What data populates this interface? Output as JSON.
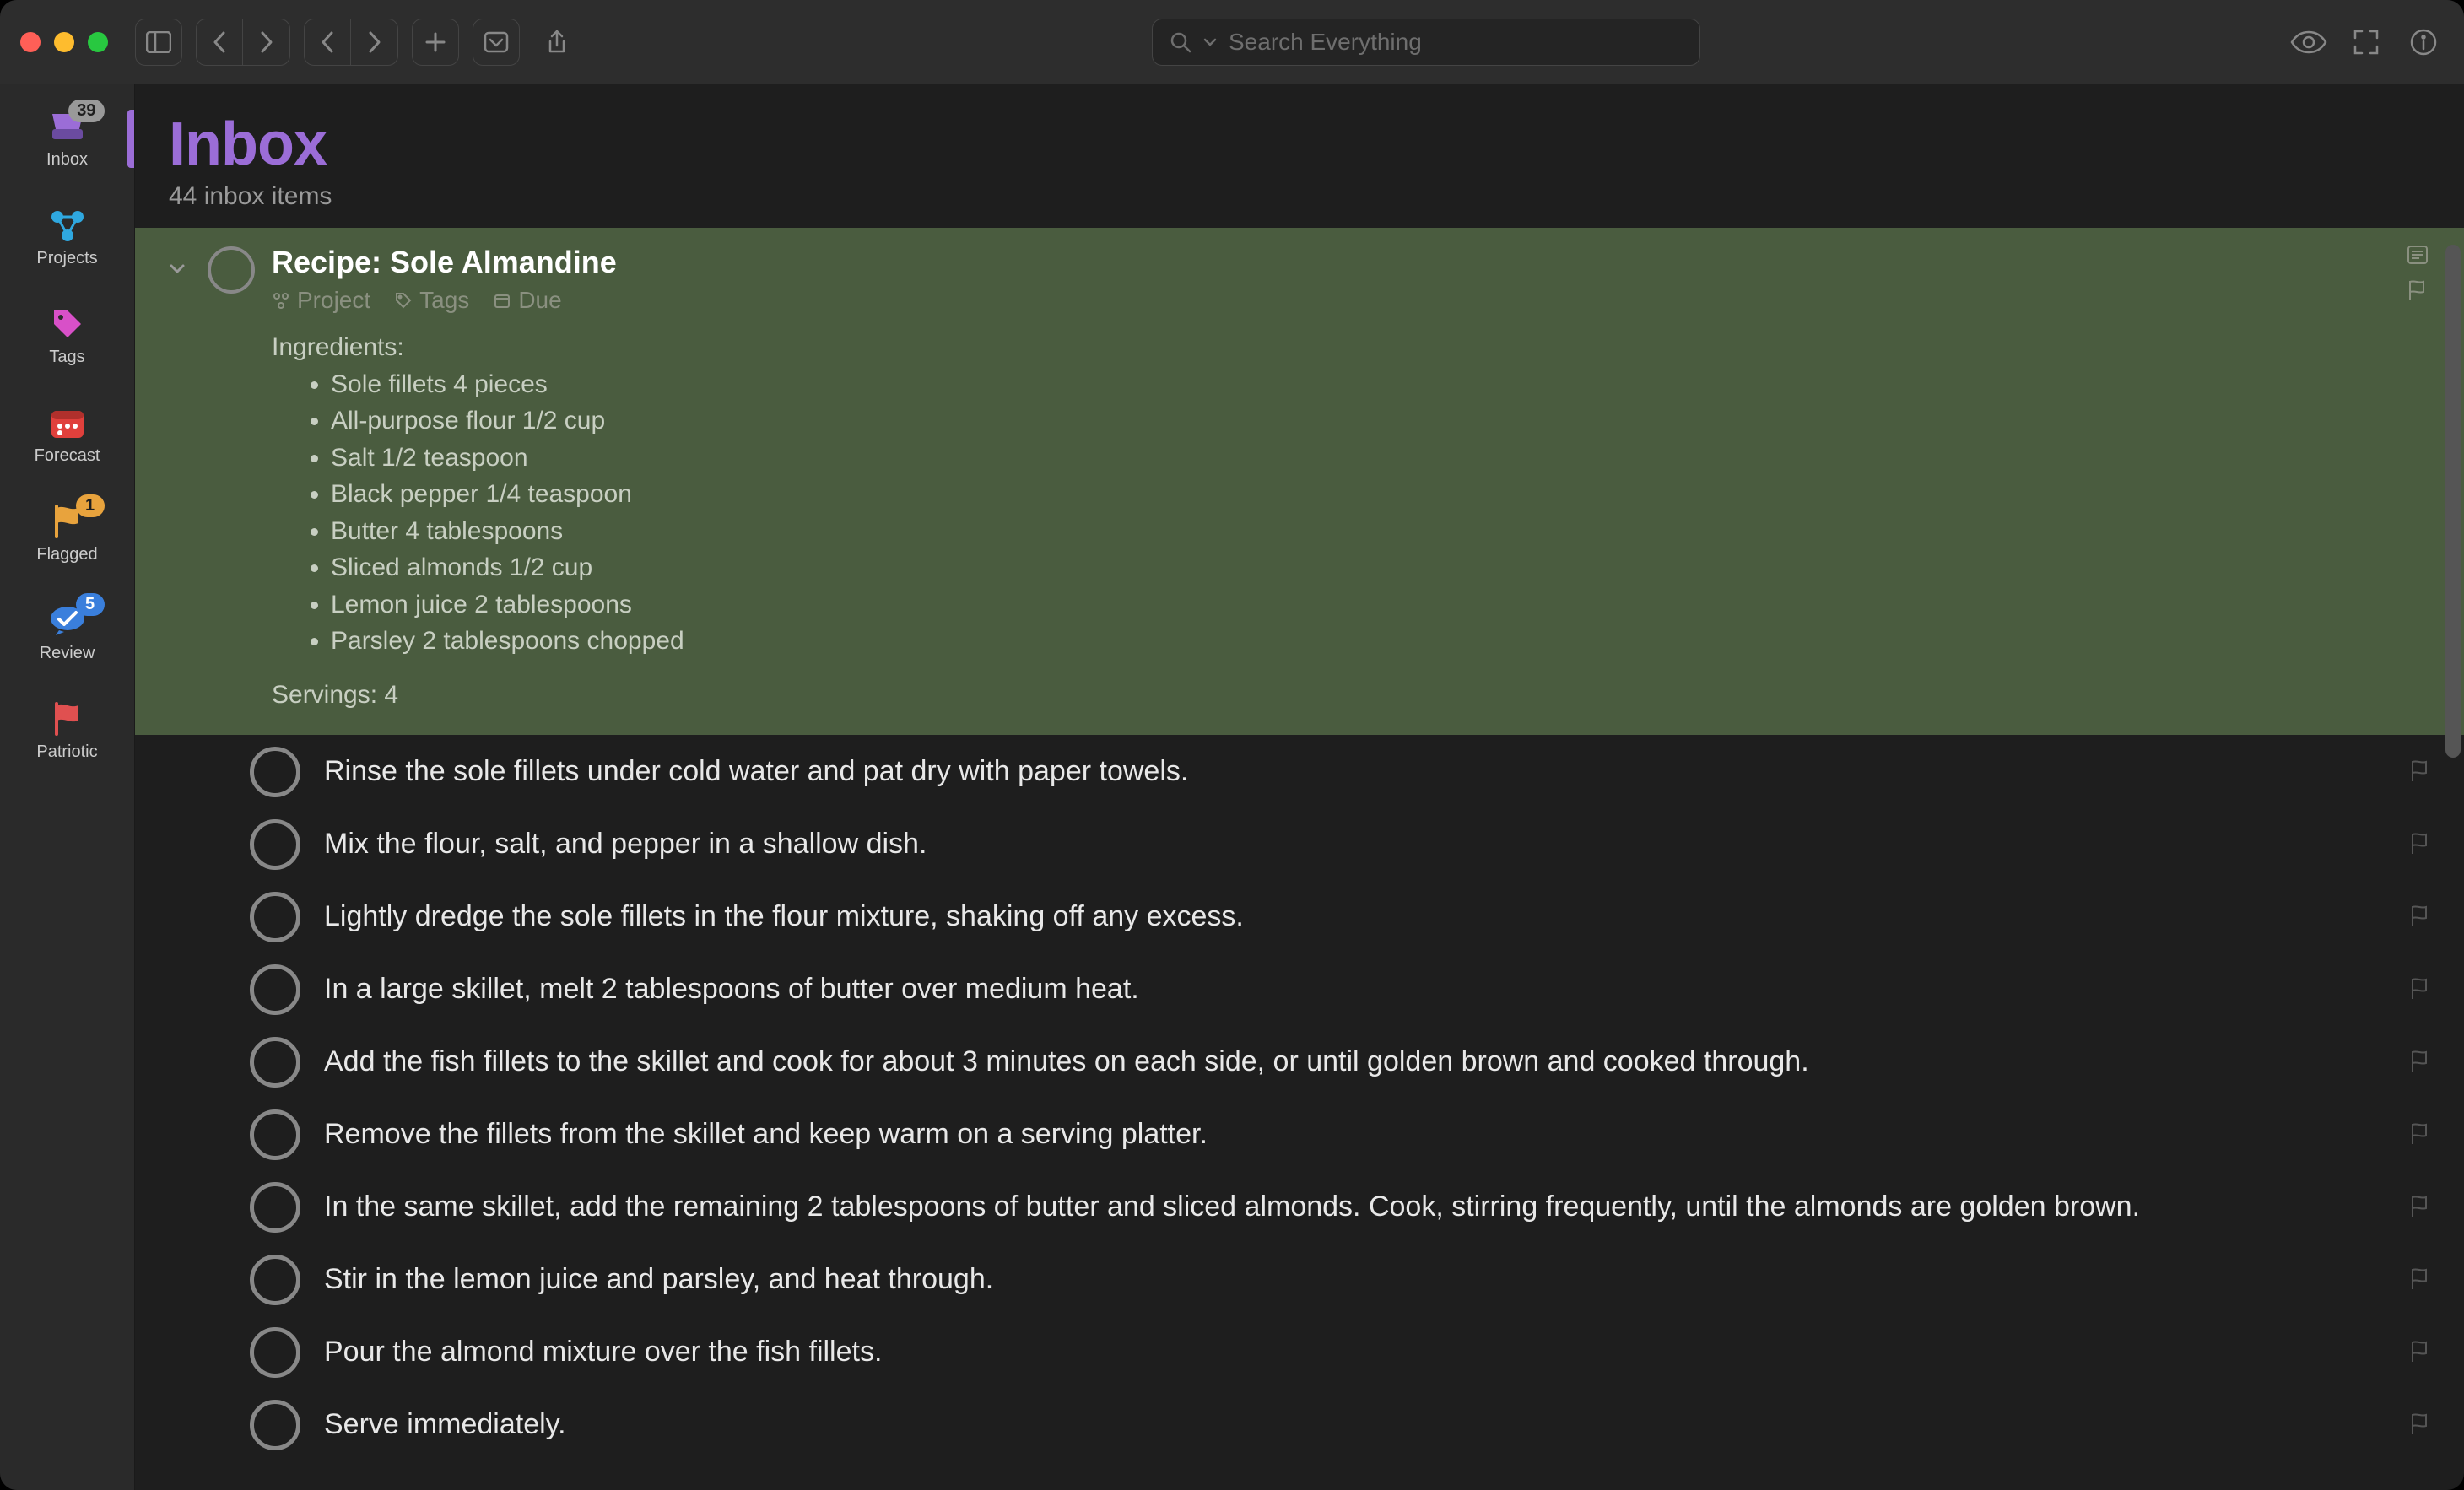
{
  "search": {
    "placeholder": "Search Everything"
  },
  "sidebar": {
    "items": [
      {
        "label": "Inbox",
        "badge": "39",
        "badge_style": "gray",
        "icon": "inbox"
      },
      {
        "label": "Projects",
        "badge": "",
        "icon": "projects"
      },
      {
        "label": "Tags",
        "badge": "",
        "icon": "tag"
      },
      {
        "label": "Forecast",
        "badge": "",
        "icon": "calendar"
      },
      {
        "label": "Flagged",
        "badge": "1",
        "badge_style": "orange",
        "icon": "flag"
      },
      {
        "label": "Review",
        "badge": "5",
        "badge_style": "blue",
        "icon": "review"
      },
      {
        "label": "Patriotic",
        "badge": "",
        "icon": "flag-red"
      }
    ]
  },
  "header": {
    "title": "Inbox",
    "subtitle": "44 inbox items"
  },
  "selected": {
    "title": "Recipe: Sole Almandine",
    "meta": {
      "project": "Project",
      "tags": "Tags",
      "due": "Due"
    },
    "note_header": "Ingredients:",
    "ingredients": [
      "Sole fillets 4 pieces",
      "All-purpose flour 1/2 cup",
      "Salt 1/2 teaspoon",
      "Black pepper 1/4 teaspoon",
      "Butter 4 tablespoons",
      "Sliced almonds 1/2 cup",
      "Lemon juice 2 tablespoons",
      "Parsley 2 tablespoons chopped"
    ],
    "servings": "Servings: 4"
  },
  "subtasks": [
    "Rinse the sole fillets under cold water and pat dry with paper towels.",
    "Mix the flour, salt, and pepper in a shallow dish.",
    "Lightly dredge the sole fillets in the flour mixture, shaking off any excess.",
    "In a large skillet, melt 2 tablespoons of butter over medium heat.",
    "Add the fish fillets to the skillet and cook for about 3 minutes on each side, or until golden brown and cooked through.",
    "Remove the fillets from the skillet and keep warm on a serving platter.",
    "In the same skillet, add the remaining 2 tablespoons of butter and sliced almonds. Cook, stirring frequently, until the almonds are golden brown.",
    "Stir in the lemon juice and parsley, and heat through.",
    "Pour the almond mixture over the fish fillets.",
    "Serve immediately."
  ]
}
